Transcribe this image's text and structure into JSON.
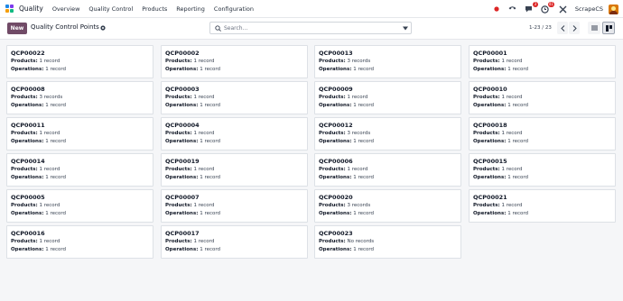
{
  "navbar": {
    "app_name": "Quality",
    "menu": [
      "Overview",
      "Quality Control",
      "Products",
      "Reporting",
      "Configuration"
    ],
    "messages_badge": "3",
    "activities_badge": "41",
    "company": "ScrapeCS"
  },
  "control": {
    "new_label": "New",
    "title": "Quality Control Points",
    "search_placeholder": "Search...",
    "pager": "1-23 / 23"
  },
  "labels": {
    "products": "Products:",
    "operations": "Operations:"
  },
  "columns": [
    [
      {
        "name": "QCP00022",
        "products": "1 record",
        "operations": "1 record"
      },
      {
        "name": "QCP00008",
        "products": "3 records",
        "operations": "1 record"
      },
      {
        "name": "QCP00011",
        "products": "1 record",
        "operations": "1 record"
      },
      {
        "name": "QCP00014",
        "products": "1 record",
        "operations": "1 record"
      },
      {
        "name": "QCP00005",
        "products": "1 record",
        "operations": "1 record"
      },
      {
        "name": "QCP00016",
        "products": "1 record",
        "operations": "1 record"
      }
    ],
    [
      {
        "name": "QCP00002",
        "products": "1 record",
        "operations": "1 record"
      },
      {
        "name": "QCP00003",
        "products": "1 record",
        "operations": "1 record"
      },
      {
        "name": "QCP00004",
        "products": "1 record",
        "operations": "1 record"
      },
      {
        "name": "QCP00019",
        "products": "1 record",
        "operations": "1 record"
      },
      {
        "name": "QCP00007",
        "products": "1 record",
        "operations": "1 record"
      },
      {
        "name": "QCP00017",
        "products": "1 record",
        "operations": "1 record"
      }
    ],
    [
      {
        "name": "QCP00013",
        "products": "3 records",
        "operations": "1 record"
      },
      {
        "name": "QCP00009",
        "products": "1 record",
        "operations": "1 record"
      },
      {
        "name": "QCP00012",
        "products": "3 records",
        "operations": "1 record"
      },
      {
        "name": "QCP00006",
        "products": "1 record",
        "operations": "1 record"
      },
      {
        "name": "QCP00020",
        "products": "3 records",
        "operations": "1 record"
      },
      {
        "name": "QCP00023",
        "products": "No records",
        "operations": "1 record"
      }
    ],
    [
      {
        "name": "QCP00001",
        "products": "1 record",
        "operations": "1 record"
      },
      {
        "name": "QCP00010",
        "products": "1 record",
        "operations": "1 record"
      },
      {
        "name": "QCP00018",
        "products": "1 record",
        "operations": "1 record"
      },
      {
        "name": "QCP00015",
        "products": "1 record",
        "operations": "1 record"
      },
      {
        "name": "QCP00021",
        "products": "1 record",
        "operations": "1 record"
      }
    ]
  ],
  "icons": {
    "logo": "odoo-quality-logo",
    "record": "record-dot-icon",
    "phone": "phone-icon",
    "messages": "chat-icon",
    "activities": "clock-icon",
    "tools": "tools-icon",
    "settings": "gear-icon",
    "search": "search-icon",
    "toggle": "caret-down-icon",
    "prev": "chevron-left-icon",
    "next": "chevron-right-icon",
    "list_view": "list-view-icon",
    "kanban_view": "kanban-view-icon"
  },
  "colors": {
    "brand": "#714b67",
    "badge": "#dc2626",
    "record_dot": "#dc2626"
  }
}
